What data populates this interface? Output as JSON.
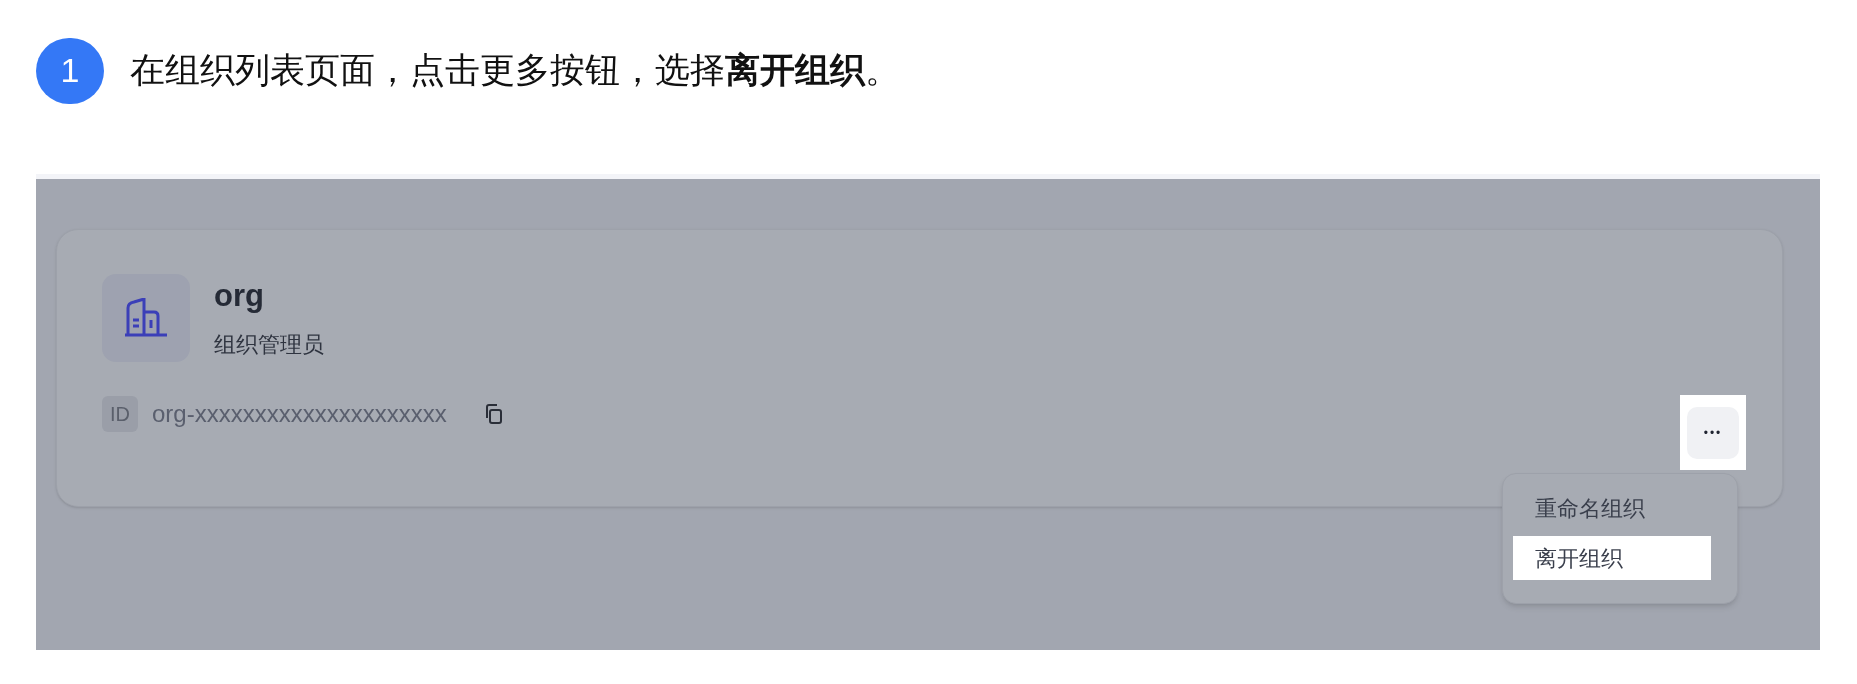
{
  "step": {
    "number": "1",
    "text": "在组织列表页面，点击更多按钮，选择**离开组织**。"
  },
  "org_card": {
    "name": "org",
    "role": "组织管理员",
    "id_label": "ID",
    "id_value": "org-xxxxxxxxxxxxxxxxxxxxx",
    "more_button": {
      "label": "•••",
      "highlighted": true
    }
  },
  "menu": {
    "items": [
      {
        "label": "重命名组织",
        "selected": false
      },
      {
        "label": "离开组织",
        "selected": true
      }
    ]
  }
}
